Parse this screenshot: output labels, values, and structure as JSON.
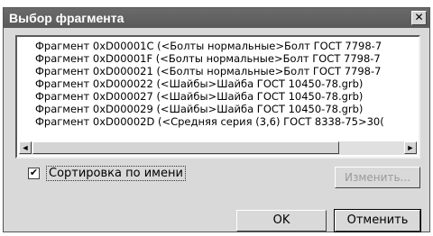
{
  "dialog": {
    "title": "Выбор фрагмента",
    "close_glyph": "✕",
    "items": [
      "Фрагмент 0xD00001C (<Болты нормальные>Болт ГОСТ 7798-7",
      "Фрагмент 0xD00001F (<Болты нормальные>Болт ГОСТ 7798-7",
      "Фрагмент 0xD000021 (<Болты нормальные>Болт ГОСТ 7798-7",
      "Фрагмент 0xD000022 (<Шайбы>Шайба ГОСТ 10450-78.grb)",
      "Фрагмент 0xD000027 (<Шайбы>Шайба ГОСТ 10450-78.grb)",
      "Фрагмент 0xD000029 (<Шайбы>Шайба ГОСТ 10450-78.grb)",
      "Фрагмент 0xD00002D (<Средняя серия (3,6) ГОСТ 8338-75>30("
    ],
    "scroll_left_glyph": "◄",
    "scroll_right_glyph": "►",
    "sort_checked": true,
    "check_glyph": "✔",
    "sort_label": "Сортировка по имени",
    "change_button": "Изменить...",
    "ok_button": "OK",
    "cancel_button": "Отменить"
  }
}
